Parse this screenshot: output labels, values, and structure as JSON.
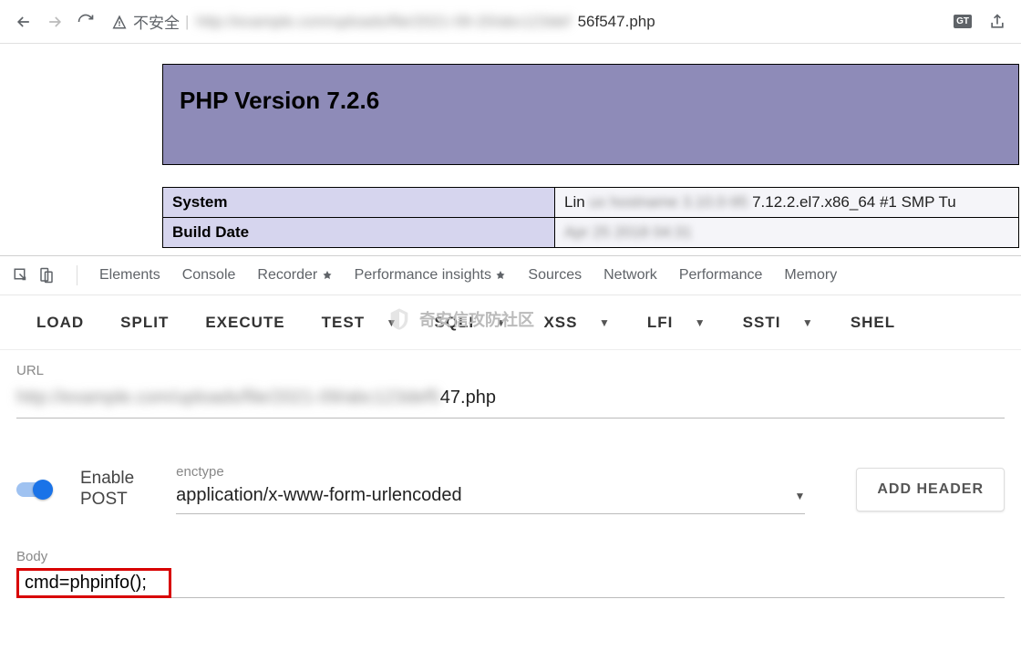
{
  "browser": {
    "security_label": "不安全",
    "url_visible_suffix": "56f547.php",
    "translate_badge": "GT"
  },
  "phpinfo": {
    "title": "PHP Version 7.2.6",
    "rows": [
      {
        "key": "System",
        "val_prefix": "Lin",
        "val_suffix": "7.12.2.el7.x86_64 #1 SMP Tu"
      },
      {
        "key": "Build Date",
        "val_prefix": "",
        "val_suffix": ""
      }
    ]
  },
  "devtools": {
    "tabs": [
      "Elements",
      "Console",
      "Recorder",
      "Performance insights",
      "Sources",
      "Network",
      "Performance",
      "Memory"
    ]
  },
  "hackbar": {
    "buttons": {
      "load": "LOAD",
      "split": "SPLIT",
      "execute": "EXECUTE",
      "test": "TEST",
      "sqli": "SQLI",
      "xss": "XSS",
      "lfi": "LFI",
      "ssti": "SSTI",
      "shell": "SHEL"
    },
    "watermark": "奇安信攻防社区"
  },
  "form": {
    "url_label": "URL",
    "url_suffix": "47.php",
    "post_toggle_label_line1": "Enable",
    "post_toggle_label_line2": "POST",
    "enctype_label": "enctype",
    "enctype_value": "application/x-www-form-urlencoded",
    "add_header_btn": "ADD HEADER",
    "body_label": "Body",
    "body_value": "cmd=phpinfo();"
  }
}
